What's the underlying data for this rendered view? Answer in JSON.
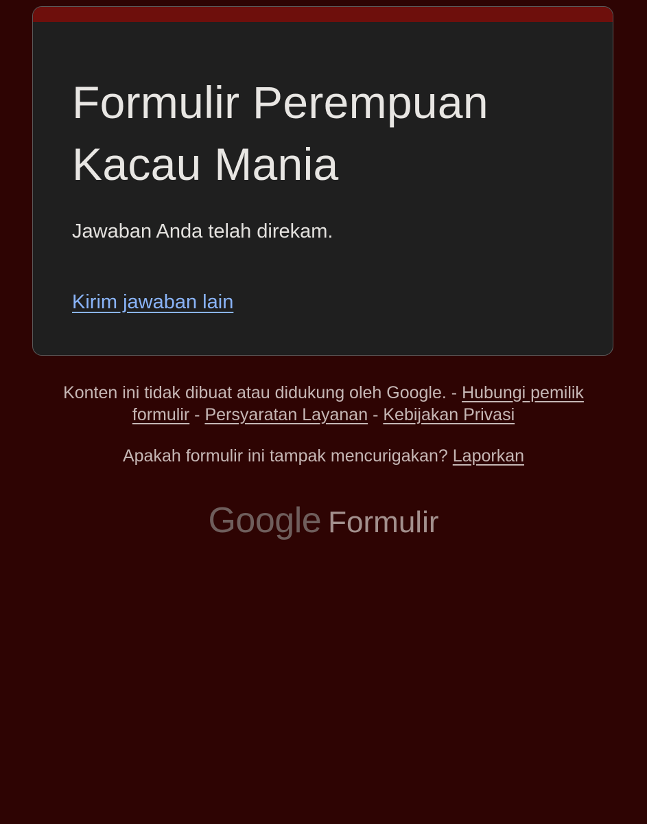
{
  "form": {
    "title": "Formulir Perempuan Kacau Mania",
    "confirmation_message": "Jawaban Anda telah direkam.",
    "submit_another_link": "Kirim jawaban lain"
  },
  "footer": {
    "disclaimer_text": "Konten ini tidak dibuat atau didukung oleh Google.",
    "separator": "-",
    "contact_owner_link": "Hubungi pemilik formulir",
    "terms_link": "Persyaratan Layanan",
    "privacy_link": "Kebijakan Privasi",
    "report_question": "Apakah formulir ini tampak mencurigakan?",
    "report_link": "Laporkan"
  },
  "branding": {
    "logo_google": "Google",
    "logo_product": "Formulir"
  },
  "colors": {
    "page_background": "#2e0403",
    "card_background": "#1f1f1f",
    "card_accent": "#6e0f0c",
    "link": "#8ab4f8"
  }
}
